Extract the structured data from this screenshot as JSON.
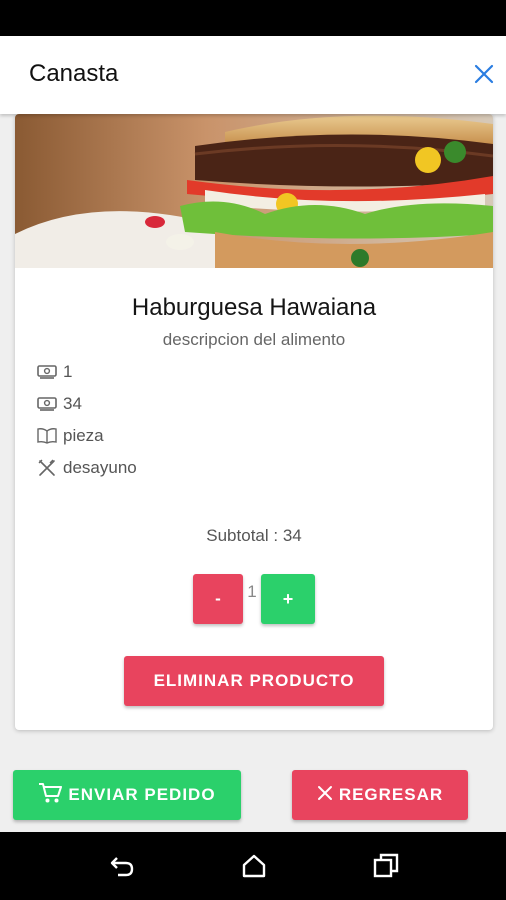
{
  "header": {
    "title": "Canasta"
  },
  "product": {
    "name": "Haburguesa Hawaiana",
    "description": "descripcion del alimento",
    "details": [
      {
        "icon": "money-icon",
        "value": "1"
      },
      {
        "icon": "money-icon",
        "value": "34"
      },
      {
        "icon": "book-icon",
        "value": "pieza"
      },
      {
        "icon": "utensils-icon",
        "value": "desayuno"
      }
    ],
    "subtotal_label": "Subtotal : 34",
    "quantity": "1",
    "decrement_label": "-",
    "increment_label": "+",
    "delete_label": "ELIMINAR PRODUCTO"
  },
  "actions": {
    "send_label": "ENVIAR PEDIDO",
    "back_label": "REGRESAR"
  },
  "colors": {
    "danger": "#e8445e",
    "success": "#2bd06b",
    "accent": "#1a73e8"
  }
}
